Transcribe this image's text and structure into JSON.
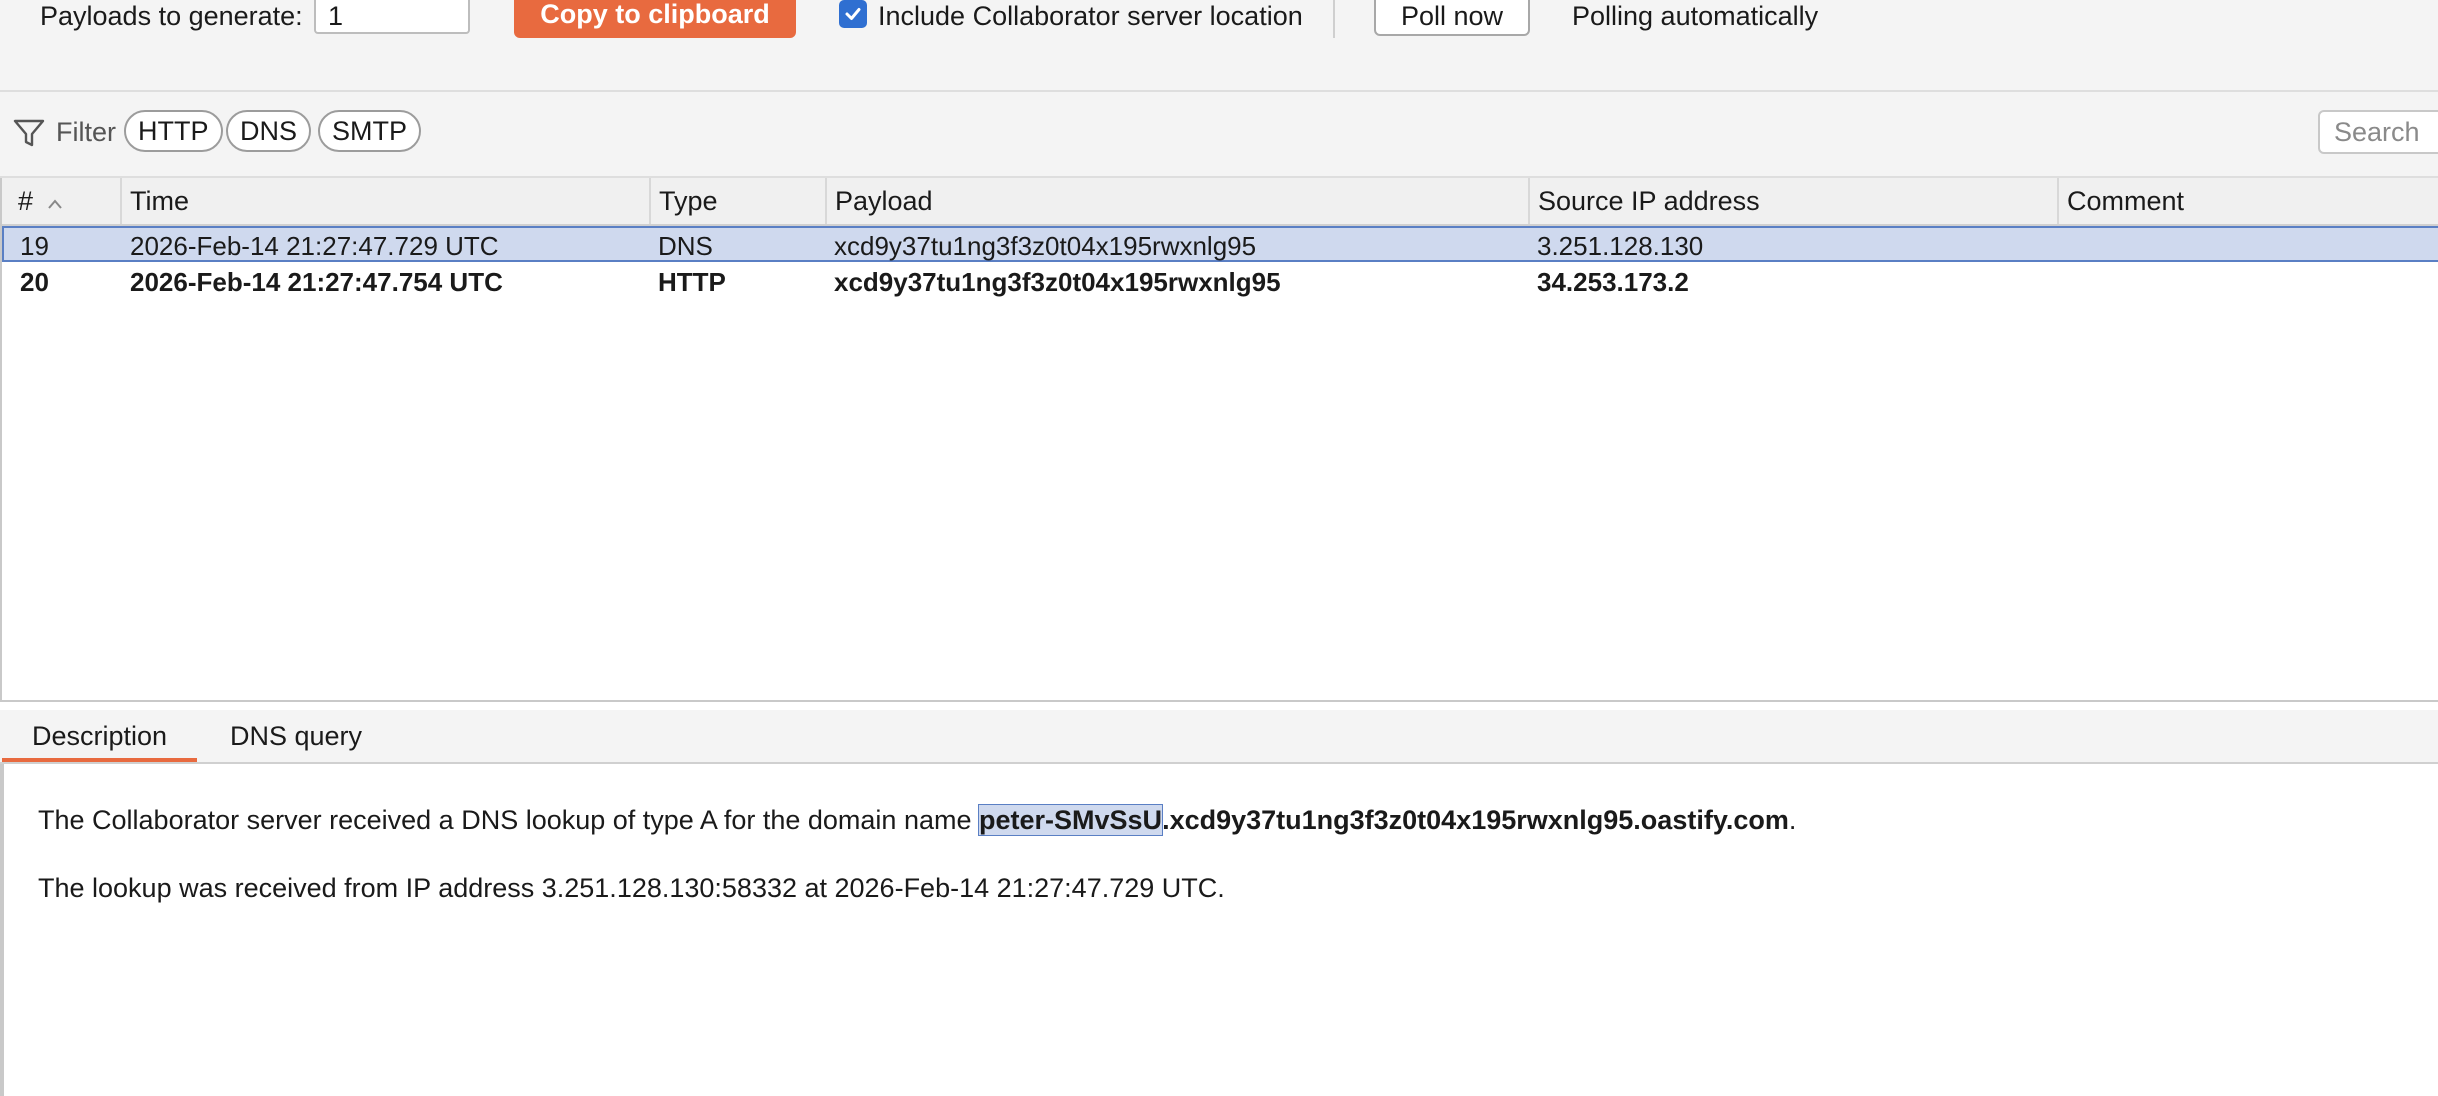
{
  "toolbar": {
    "payloads_label": "Payloads to generate:",
    "payloads_value": "1",
    "copy_button": "Copy to clipboard",
    "include_location_label": "Include Collaborator server location",
    "include_location_checked": true,
    "poll_button": "Poll now",
    "polling_status": "Polling automatically"
  },
  "filter": {
    "label": "Filter",
    "pills": [
      "HTTP",
      "DNS",
      "SMTP"
    ],
    "search_placeholder": "Search"
  },
  "table": {
    "columns": [
      "#",
      "Time",
      "Type",
      "Payload",
      "Source IP address",
      "Comment"
    ],
    "rows": [
      {
        "num": "19",
        "time": "2026-Feb-14 21:27:47.729 UTC",
        "type": "DNS",
        "payload": "xcd9y37tu1ng3f3z0t04x195rwxnlg95",
        "ip": "3.251.128.130",
        "comment": "",
        "selected": true,
        "bold": false
      },
      {
        "num": "20",
        "time": "2026-Feb-14 21:27:47.754 UTC",
        "type": "HTTP",
        "payload": "xcd9y37tu1ng3f3z0t04x195rwxnlg95",
        "ip": "34.253.173.2",
        "comment": "",
        "selected": false,
        "bold": true
      }
    ]
  },
  "detail_tabs": [
    "Description",
    "DNS query"
  ],
  "description": {
    "line1_prefix": "The Collaborator server received a DNS lookup of type A for the domain name ",
    "line1_highlight": "peter-SMvSsU",
    "line1_domain_rest": ".xcd9y37tu1ng3f3z0t04x195rwxnlg95.oastify.com",
    "line1_suffix": ".",
    "line2": "The lookup was received from IP address 3.251.128.130:58332 at 2026-Feb-14 21:27:47.729 UTC."
  },
  "colors": {
    "accent_orange": "#e86a3f",
    "selection_blue": "#cfd9ee",
    "checkbox_blue": "#2f6fd1"
  }
}
